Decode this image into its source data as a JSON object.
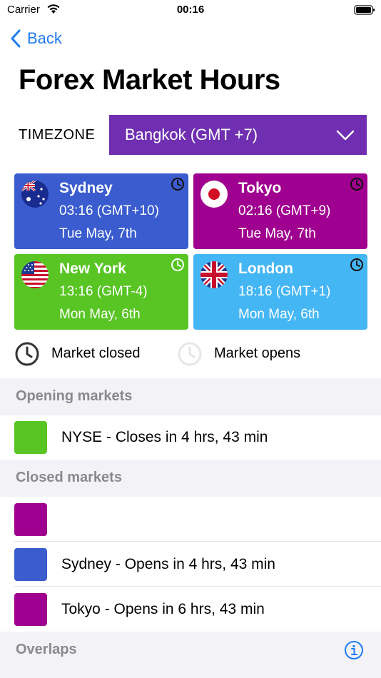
{
  "status_bar": {
    "carrier": "Carrier",
    "time": "00:16"
  },
  "nav": {
    "back_label": "Back"
  },
  "page": {
    "title": "Forex Market Hours"
  },
  "timezone": {
    "label": "TIMEZONE",
    "selected": "Bangkok (GMT +7)"
  },
  "cities": [
    {
      "name": "Sydney",
      "time": "03:16 (GMT+10)",
      "date": "Tue May, 7th",
      "color": "#3a5cce",
      "status": "closed"
    },
    {
      "name": "Tokyo",
      "time": "02:16 (GMT+9)",
      "date": "Tue May, 7th",
      "color": "#a0008f",
      "status": "closed"
    },
    {
      "name": "New York",
      "time": "13:16 (GMT-4)",
      "date": "Mon May, 6th",
      "color": "#58c524",
      "status": "open"
    },
    {
      "name": "London",
      "time": "18:16 (GMT+1)",
      "date": "Mon May, 6th",
      "color": "#45b6f4",
      "status": "closed"
    }
  ],
  "legend": {
    "closed_label": "Market closed",
    "opens_label": "Market opens"
  },
  "sections": {
    "opening": {
      "title": "Opening markets",
      "items": [
        {
          "text": "NYSE - Closes in 4 hrs, 43 min",
          "color": "#58c524"
        }
      ]
    },
    "closed": {
      "title": "Closed markets",
      "items": [
        {
          "text": "",
          "color": "#a0008f"
        },
        {
          "text": "Sydney - Opens in 4 hrs, 43 min",
          "color": "#3a5cce"
        },
        {
          "text": "Tokyo - Opens in 6 hrs, 43 min",
          "color": "#a0008f"
        }
      ]
    },
    "overlaps": {
      "title": "Overlaps"
    }
  },
  "colors": {
    "accent": "#1f7bf2",
    "timezone_bg": "#6f2fb0",
    "section_bg": "#f2f2f7"
  }
}
